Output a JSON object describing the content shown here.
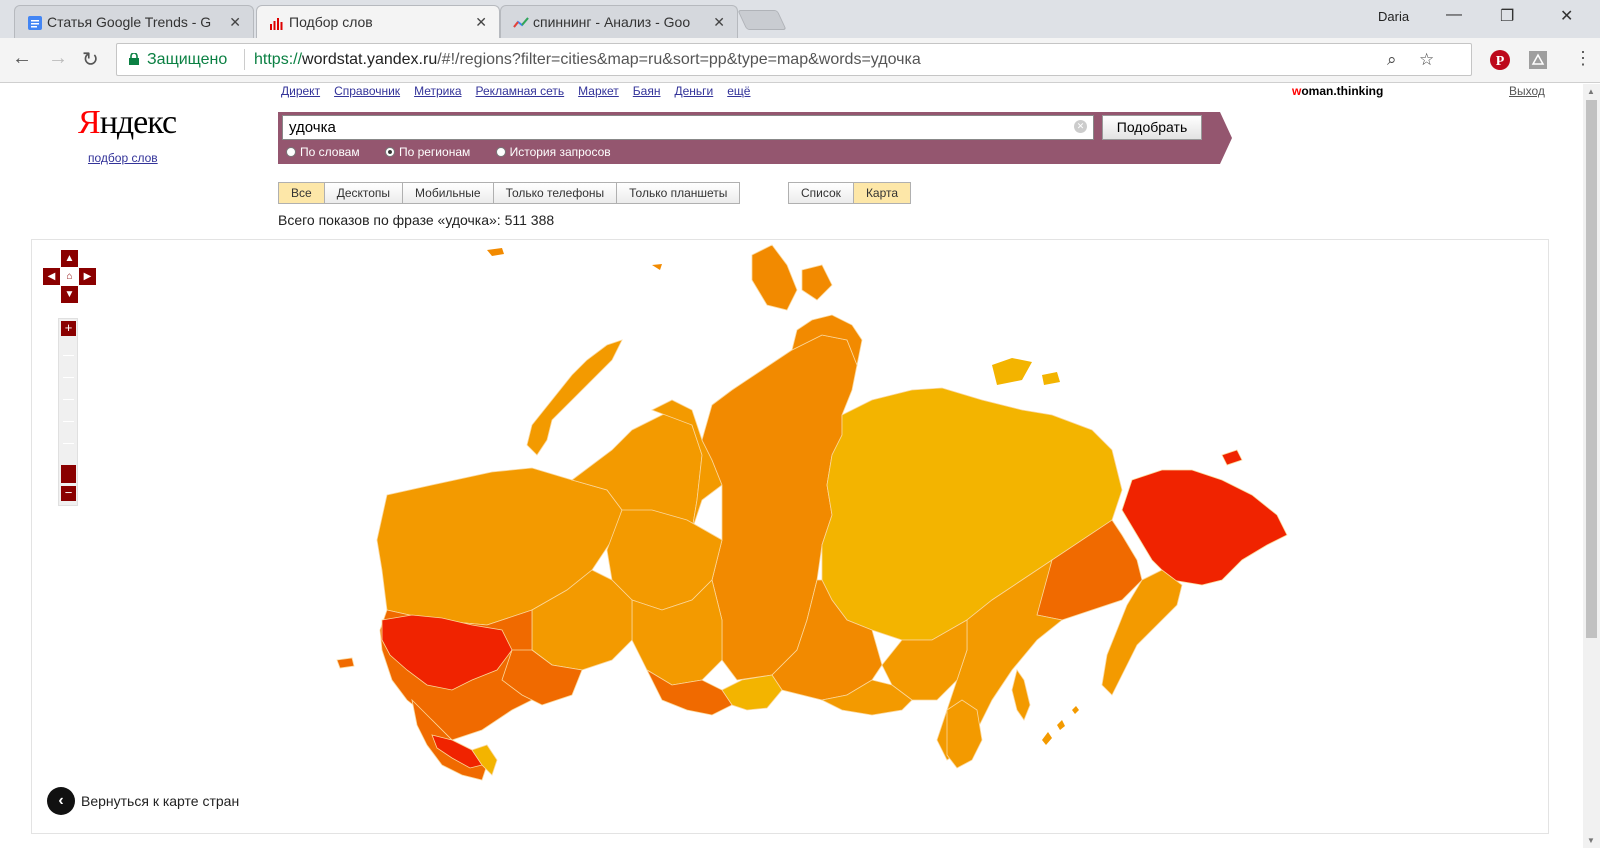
{
  "browser": {
    "tabs": [
      {
        "title": "Статья Google Trends - G",
        "icon": "google-docs-icon"
      },
      {
        "title": "Подбор слов",
        "icon": "wordstat-bars-icon",
        "active": true
      },
      {
        "title": "спиннинг - Анализ - Goo",
        "icon": "google-trends-icon"
      }
    ],
    "user": "Daria",
    "secure_label": "Защищено",
    "url_scheme": "https://",
    "url_host": "wordstat.yandex.ru",
    "url_rest": "/#!/regions?filter=cities&map=ru&sort=pp&type=map&words=удочка"
  },
  "header": {
    "logo": "Яндекс",
    "logo_first_letter": "Я",
    "logo_rest": "ндекс",
    "sublogo": "подбор слов",
    "services": [
      "Директ",
      "Справочник",
      "Метрика",
      "Рекламная сеть",
      "Маркет",
      "Баян",
      "Деньги",
      "ещё"
    ],
    "username_first": "w",
    "username_rest": "oman.thinking",
    "logout": "Выход"
  },
  "search": {
    "query": "удочка",
    "button": "Подобрать",
    "modes": [
      "По словам",
      "По регионам",
      "История запросов"
    ],
    "selected_mode": "По регионам"
  },
  "filters": {
    "devices": [
      "Все",
      "Десктопы",
      "Мобильные",
      "Только телефоны",
      "Только планшеты"
    ],
    "selected_device": "Все",
    "views": [
      "Список",
      "Карта"
    ],
    "selected_view": "Карта"
  },
  "summary": {
    "total_text": "Всего показов по фразе «удочка»: 511 388"
  },
  "map": {
    "back_label": "Вернуться к карте стран",
    "palette": {
      "low": "#f3b400",
      "mid": "#f28a00",
      "high": "#f06a00",
      "max": "#f02300"
    }
  }
}
